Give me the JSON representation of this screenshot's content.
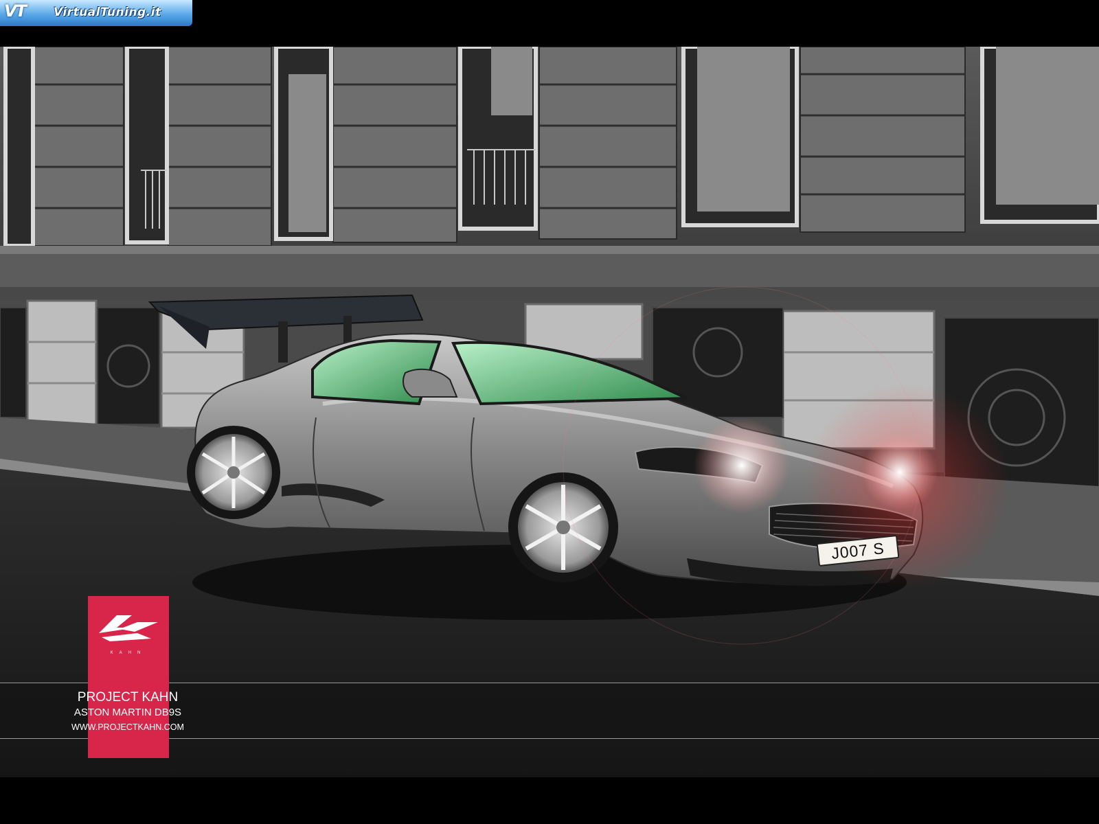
{
  "site_logo": {
    "mark": "VT",
    "text": "VirtualTuning.it"
  },
  "image": {
    "subject": "Silver sports coupe parked on a city street in front of a stone building",
    "license_plate": "J007 S"
  },
  "brand_tag": {
    "word": "KAHN",
    "color": "#d8264a"
  },
  "credit": {
    "title": "PROJECT KAHN",
    "model": "ASTON MARTIN DB9S",
    "url": "WWW.PROJECTKAHN.COM"
  }
}
